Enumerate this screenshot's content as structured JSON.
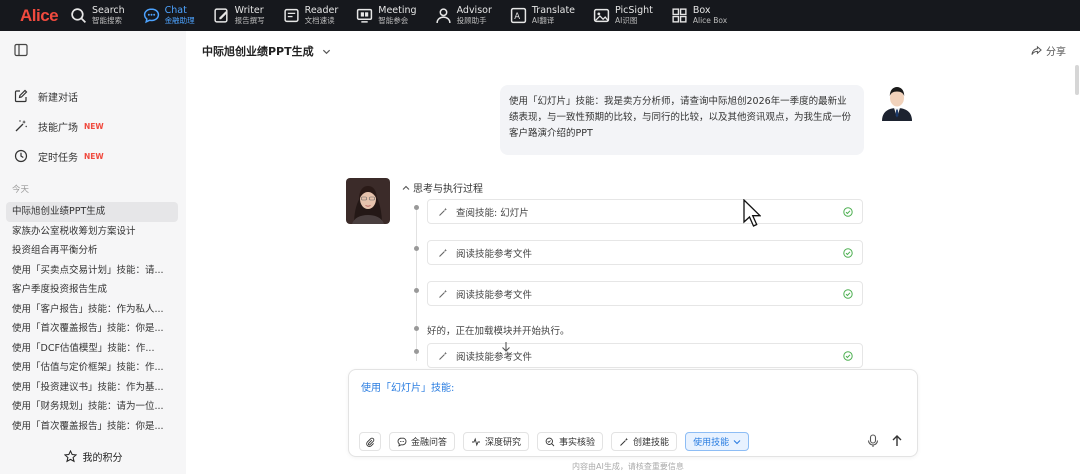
{
  "app": {
    "logo": "Alice"
  },
  "nav": [
    {
      "main": "Search",
      "sub": "智能搜索",
      "icon": "search-icon",
      "active": false
    },
    {
      "main": "Chat",
      "sub": "金融助理",
      "icon": "chat-icon",
      "active": true
    },
    {
      "main": "Writer",
      "sub": "报告撰写",
      "icon": "writer-icon",
      "active": false
    },
    {
      "main": "Reader",
      "sub": "文档速读",
      "icon": "reader-icon",
      "active": false
    },
    {
      "main": "Meeting",
      "sub": "智能参会",
      "icon": "meeting-icon",
      "active": false
    },
    {
      "main": "Advisor",
      "sub": "投顾助手",
      "icon": "advisor-icon",
      "active": false
    },
    {
      "main": "Translate",
      "sub": "AI翻译",
      "icon": "translate-icon",
      "active": false
    },
    {
      "main": "PicSight",
      "sub": "AI识图",
      "icon": "picsight-icon",
      "active": false
    },
    {
      "main": "Box",
      "sub": "Alice Box",
      "icon": "box-icon",
      "active": false
    }
  ],
  "sidebar": {
    "menu": [
      {
        "label": "新建对话",
        "badge": "",
        "icon": "new-chat-icon"
      },
      {
        "label": "技能广场",
        "badge": "NEW",
        "icon": "wand-icon"
      },
      {
        "label": "定时任务",
        "badge": "NEW",
        "icon": "clock-icon"
      }
    ],
    "section_label": "今天",
    "history": [
      "中际旭创业绩PPT生成",
      "家族办公室税收筹划方案设计",
      "投资组合再平衡分析",
      "使用「买卖点交易计划」技能：请...",
      "客户季度投资报告生成",
      "使用「客户报告」技能：作为私人...",
      "使用「首次覆盖报告」技能：你是...",
      "使用「DCF估值模型」技能：作...",
      "使用「估值与定价框架」技能：作...",
      "使用「投资建议书」技能：作为基...",
      "使用「财务规划」技能：请为一位...",
      "使用「首次覆盖报告」技能：你是..."
    ],
    "points_label": "我的积分"
  },
  "main": {
    "title": "中际旭创业绩PPT生成",
    "share_label": "分享",
    "user_message": "使用「幻灯片」技能：我是卖方分析师，请查询中际旭创2026年一季度的最新业绩表现，与一致性预期的比较，与同行的比较，以及其他资讯观点，为我生成一份客户路演介绍的PPT",
    "thinking_label": "思考与执行过程",
    "steps": [
      {
        "label": "查阅技能: 幻灯片"
      },
      {
        "label": "阅读技能参考文件"
      },
      {
        "label": "阅读技能参考文件"
      }
    ],
    "status_text": "好的，正在加载模块并开始执行。",
    "partial_step": "阅读技能参考文件"
  },
  "composer": {
    "prompt_text": "使用「幻灯片」技能:",
    "tools": [
      {
        "label": "金融问答",
        "icon": "qa-icon"
      },
      {
        "label": "深度研究",
        "icon": "research-icon"
      },
      {
        "label": "事实核验",
        "icon": "verify-icon"
      },
      {
        "label": "创建技能",
        "icon": "create-skill-icon"
      }
    ],
    "skill_button": "使用技能",
    "disclaimer": "内容由AI生成，请核查重要信息"
  },
  "colors": {
    "accent": "#2a7de1",
    "brand": "#f04a3e",
    "topbar": "#16181d",
    "sidebar": "#f6f6f7",
    "check": "#4caf50"
  }
}
